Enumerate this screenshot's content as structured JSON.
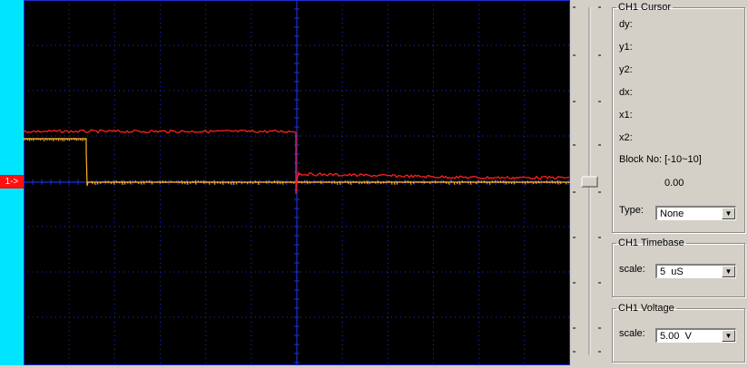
{
  "scope": {
    "channel_marker": "1->"
  },
  "ch1_cursor": {
    "title": "CH1 Cursor",
    "dy_label": "dy:",
    "y1_label": "y1:",
    "y2_label": "y2:",
    "dx_label": "dx:",
    "x1_label": "x1:",
    "x2_label": "x2:",
    "block_label": "Block No: [-10~10]",
    "block_value": "0.00",
    "type_label": "Type:",
    "type_value": "None"
  },
  "ch1_timebase": {
    "title": "CH1 Timebase",
    "scale_label": "scale:",
    "scale_value": "5  uS"
  },
  "ch1_voltage": {
    "title": "CH1 Voltage",
    "scale_label": "scale:",
    "scale_value": "5.00  V"
  },
  "colors": {
    "grid": "#1a2fd6",
    "ch1_trace": "#ff2020",
    "ch2_trace": "#ffb428",
    "strip": "#00e5ff"
  },
  "slider": {
    "position_fraction": 0.5
  }
}
